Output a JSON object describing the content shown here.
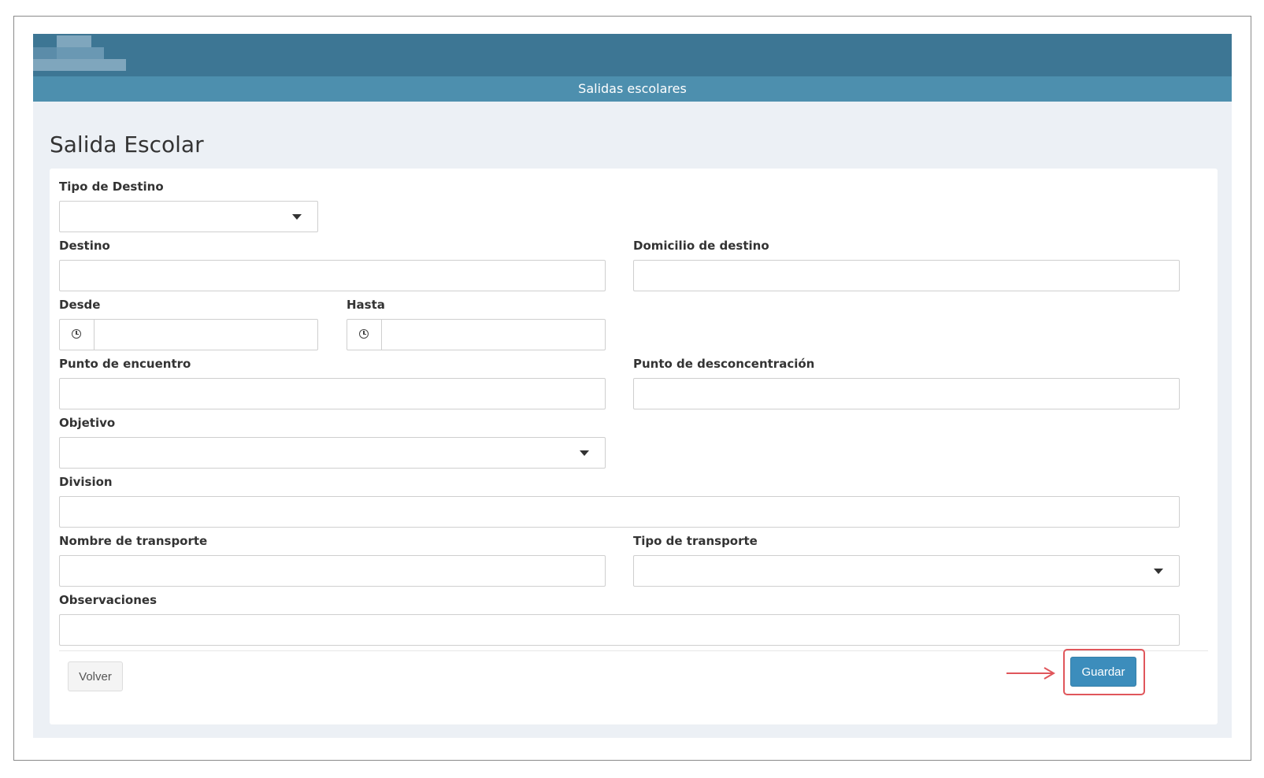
{
  "header": {
    "subtitle": "Salidas escolares"
  },
  "page": {
    "title": "Salida Escolar"
  },
  "form": {
    "tipo_destino": {
      "label": "Tipo de Destino",
      "value": ""
    },
    "destino": {
      "label": "Destino",
      "value": ""
    },
    "domicilio_destino": {
      "label": "Domicilio de destino",
      "value": ""
    },
    "desde": {
      "label": "Desde",
      "value": ""
    },
    "hasta": {
      "label": "Hasta",
      "value": ""
    },
    "punto_encuentro": {
      "label": "Punto de encuentro",
      "value": ""
    },
    "punto_desconcentracion": {
      "label": "Punto de desconcentración",
      "value": ""
    },
    "objetivo": {
      "label": "Objetivo",
      "value": ""
    },
    "division": {
      "label": "Division",
      "value": ""
    },
    "nombre_transporte": {
      "label": "Nombre de transporte",
      "value": ""
    },
    "tipo_transporte": {
      "label": "Tipo de transporte",
      "value": ""
    },
    "observaciones": {
      "label": "Observaciones",
      "value": ""
    }
  },
  "actions": {
    "back_label": "Volver",
    "save_label": "Guardar"
  },
  "colors": {
    "topbar": "#3d7694",
    "subbar": "#4d8fae",
    "background": "#ecf0f5",
    "primary_button": "#3c8dbc",
    "highlight": "#e0565b"
  },
  "icons": [
    "clock-icon",
    "caret-down-icon",
    "arrow-right-icon"
  ]
}
